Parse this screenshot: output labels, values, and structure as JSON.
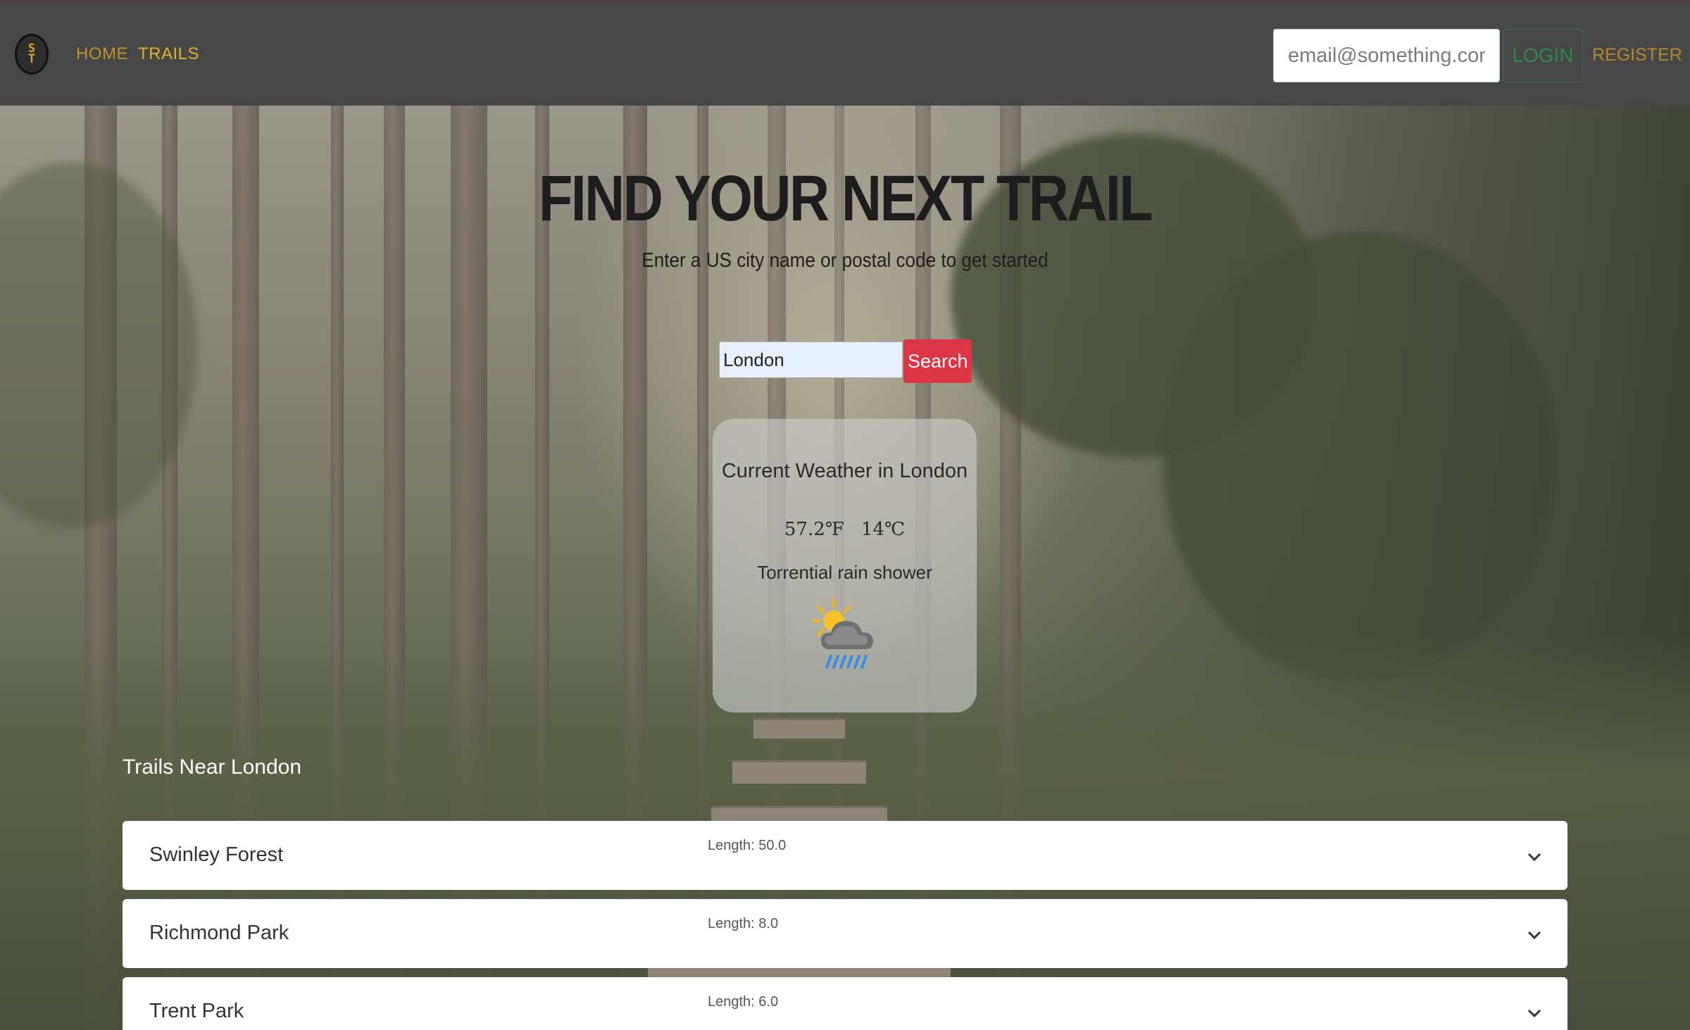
{
  "nav": {
    "logo_letters": [
      "S",
      "T"
    ],
    "home_label": "HOME",
    "trails_label": "TRAILS",
    "email_placeholder": "email@something.com",
    "login_label": "LOGIN",
    "register_label": "REGISTER"
  },
  "hero": {
    "title": "FIND YOUR NEXT TRAIL",
    "subtitle": "Enter a US city name or postal code to get started",
    "search_value": "London",
    "search_button": "Search"
  },
  "weather": {
    "title": "Current Weather in London",
    "temp_f": "57.2℉",
    "temp_c": "14℃",
    "description": "Torrential rain shower",
    "icon": "sun-behind-rain-cloud-icon"
  },
  "trails": {
    "heading": "Trails Near London",
    "items": [
      {
        "name": "Swinley Forest",
        "length": "Length: 50.0"
      },
      {
        "name": "Richmond Park",
        "length": "Length: 8.0"
      },
      {
        "name": "Trent Park",
        "length": "Length: 6.0"
      }
    ]
  },
  "colors": {
    "nav_bg": "#474747",
    "accent_gold": "#e0b12a",
    "login_green": "#2f8a4d",
    "search_red": "#dc3545"
  }
}
